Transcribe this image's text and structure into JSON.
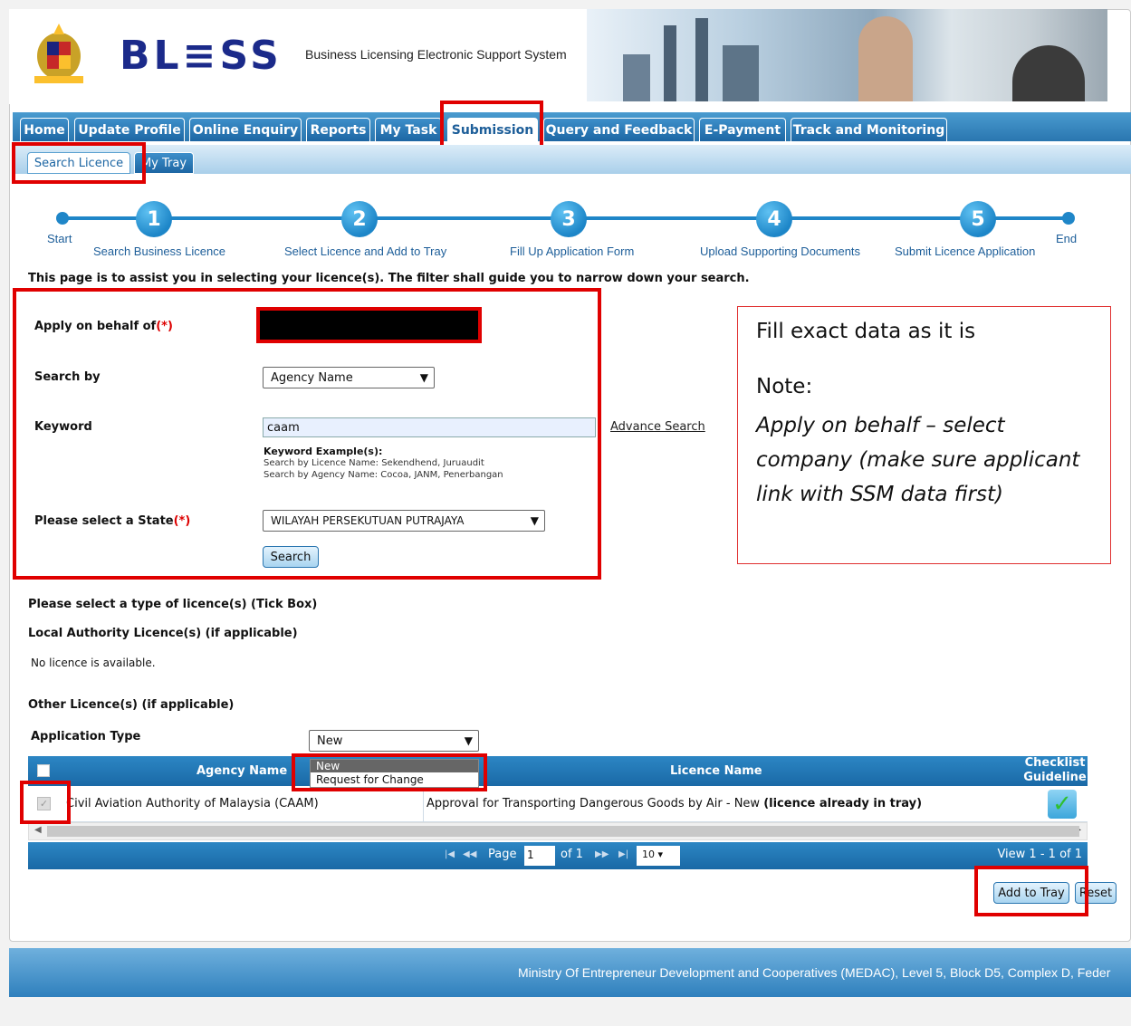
{
  "header": {
    "logo_text": "BL≡SS",
    "subtitle": "Business Licensing Electronic Support System"
  },
  "nav": {
    "tabs": [
      "Home",
      "Update Profile",
      "Online Enquiry",
      "Reports",
      "My Task",
      "Submission",
      "Query and Feedback",
      "E-Payment",
      "Track and Monitoring"
    ],
    "active": "Submission"
  },
  "subnav": {
    "tabs": [
      "Search Licence",
      "My Tray"
    ]
  },
  "steps": {
    "start": "Start",
    "end": "End",
    "items": [
      {
        "num": "1",
        "label": "Search Business Licence"
      },
      {
        "num": "2",
        "label": "Select Licence and Add to Tray"
      },
      {
        "num": "3",
        "label": "Fill Up Application Form"
      },
      {
        "num": "4",
        "label": "Upload Supporting Documents"
      },
      {
        "num": "5",
        "label": "Submit Licence Application"
      }
    ]
  },
  "intro": "This page is to assist you in selecting your licence(s). The filter shall guide you to narrow down your search.",
  "form": {
    "apply_label": "Apply on behalf of",
    "req": "(*)",
    "search_by_label": "Search by",
    "search_by_value": "Agency Name",
    "keyword_label": "Keyword",
    "keyword_value": "caam",
    "advance_search": "Advance Search",
    "example_title": "Keyword Example(s):",
    "example_1": "Search by Licence Name: Sekendhend, Juruaudit",
    "example_2": "Search by Agency Name: Cocoa, JANM, Penerbangan",
    "state_label": "Please select a State",
    "state_value": "WILAYAH PERSEKUTUAN PUTRAJAYA",
    "search_button": "Search"
  },
  "note": {
    "line1": "Fill exact data as it is",
    "line2": "Note:",
    "line3": "Apply on behalf – select company (make sure applicant link with SSM data first)"
  },
  "licences": {
    "select_type": "Please select a type of licence(s) (Tick Box)",
    "local_title": "Local Authority Licence(s) (if applicable)",
    "no_licence": "No licence is available.",
    "other_title": "Other Licence(s) (if applicable)",
    "app_type_label": "Application Type",
    "app_type_value": "New",
    "app_type_options": [
      "New",
      "Request for Change"
    ]
  },
  "grid": {
    "col_agency": "Agency Name",
    "col_licence": "Licence Name",
    "col_checklist": "Checklist Guideline",
    "row": {
      "agency": "Civil Aviation Authority of Malaysia (CAAM)",
      "licence": "Approval for Transporting Dangerous Goods by Air - New",
      "licence_note": "(licence already in tray)"
    },
    "pager": {
      "page_label": "Page",
      "page_value": "1",
      "of_label": "of 1",
      "per_page": "10",
      "view": "View 1 - 1 of 1"
    }
  },
  "actions": {
    "add_to_tray": "Add to Tray",
    "reset": "Reset"
  },
  "footer": "Ministry Of Entrepreneur Development and Cooperatives (MEDAC), Level 5, Block D5, Complex D, Feder"
}
